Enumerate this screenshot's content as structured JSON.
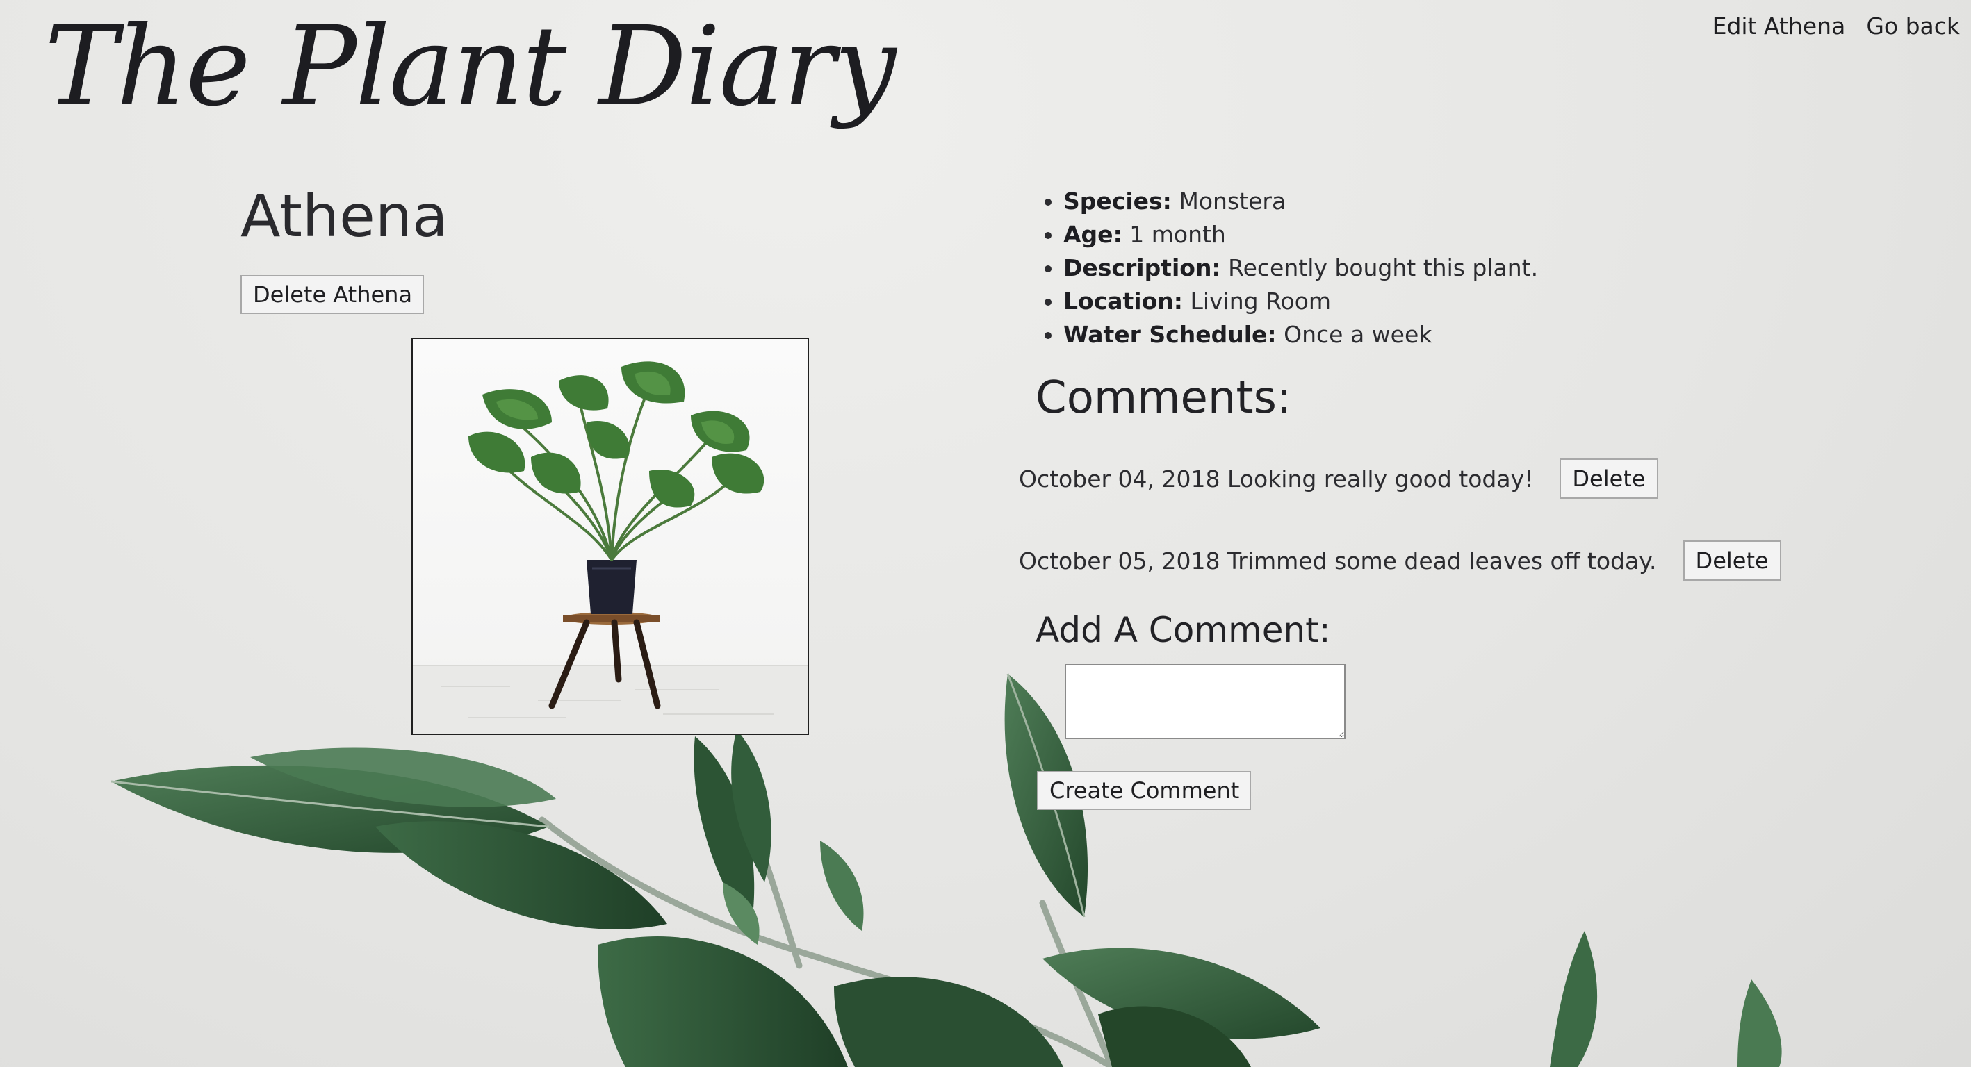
{
  "app": {
    "logo_text": "The Plant Diary"
  },
  "nav": {
    "edit_label": "Edit Athena",
    "back_label": "Go back"
  },
  "plant": {
    "name": "Athena",
    "delete_label": "Delete Athena",
    "details": [
      {
        "label": "Species:",
        "value": "Monstera"
      },
      {
        "label": "Age:",
        "value": "1 month"
      },
      {
        "label": "Description:",
        "value": "Recently bought this plant."
      },
      {
        "label": "Location:",
        "value": "Living Room"
      },
      {
        "label": "Water Schedule:",
        "value": "Once a week"
      }
    ]
  },
  "comments": {
    "title": "Comments:",
    "items": [
      {
        "text": "October 04, 2018 Looking really good today!",
        "delete_label": "Delete"
      },
      {
        "text": "October 05, 2018 Trimmed some dead leaves off today.",
        "delete_label": "Delete"
      }
    ]
  },
  "add_comment": {
    "title": "Add A Comment:",
    "value": "",
    "submit_label": "Create Comment"
  },
  "colors": {
    "background": "#e8e8e6",
    "text": "#1f1f22",
    "leaf": "#2f5f3a",
    "button_bg": "#f3f3f3",
    "button_border": "#a8a8a8"
  }
}
